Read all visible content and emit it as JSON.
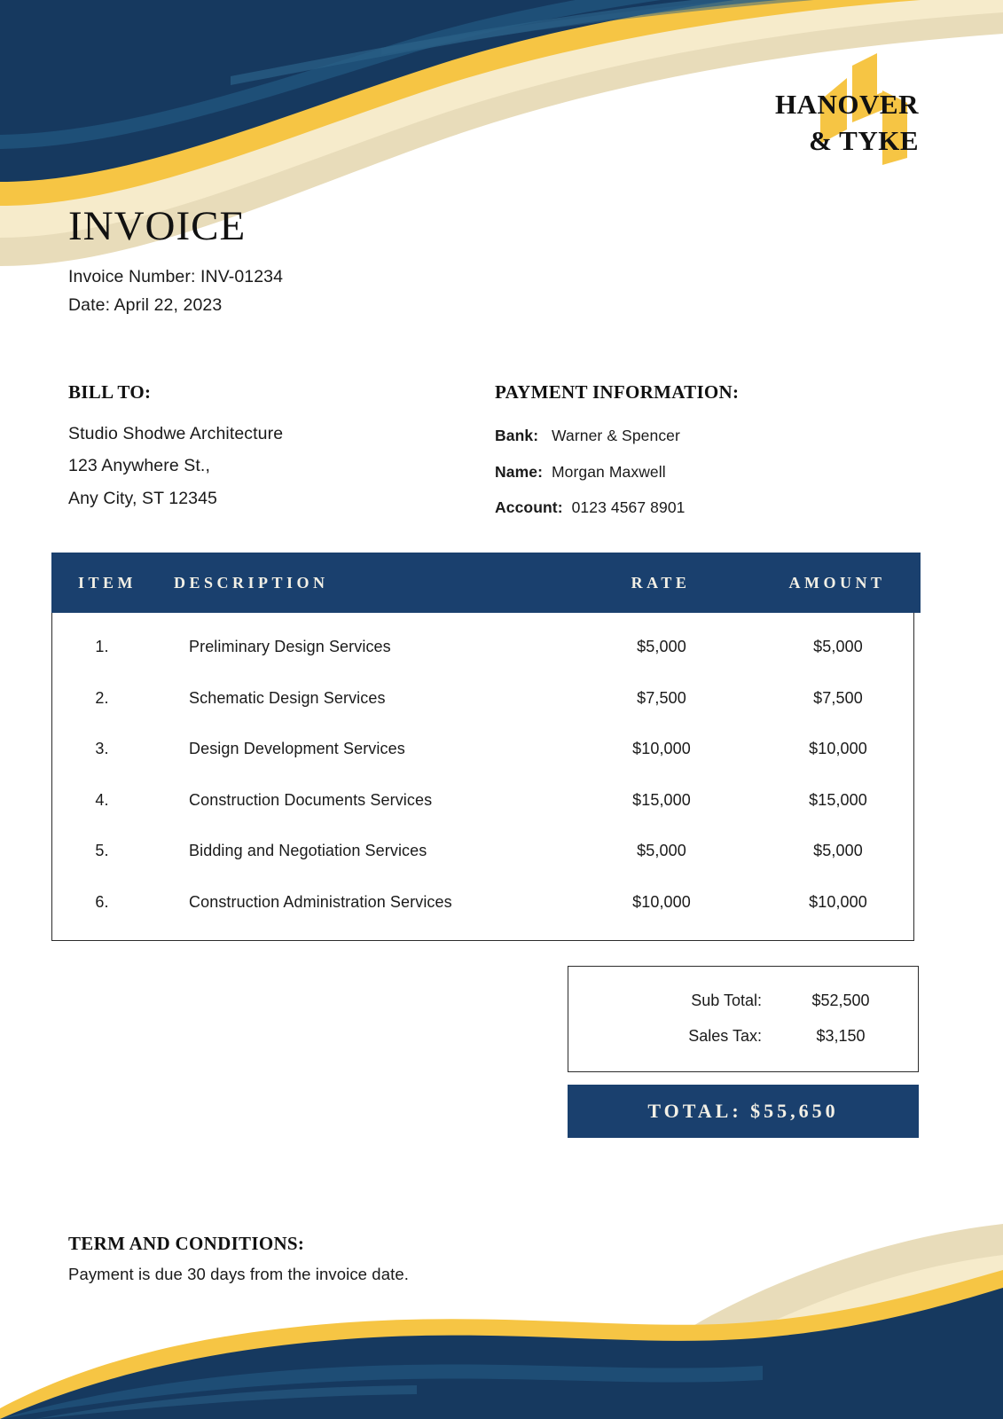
{
  "brand": {
    "logo_line1": "HANOVER",
    "logo_line2": "& TYKE",
    "logo_mark": "stylized-h-monogram",
    "navy": "#1A406E",
    "navy_dark": "#16395F",
    "blue_mid": "#1F5078",
    "gold": "#F6C544",
    "cream": "#F6EBCB",
    "cream_dark": "#E8DCBA",
    "header_text": "#F3F0E6"
  },
  "document": {
    "title": "INVOICE",
    "invoice_number_line": "Invoice Number: INV-01234",
    "date_line": "Date: April 22, 2023"
  },
  "bill_to": {
    "heading": "BILL TO:",
    "lines": [
      "Studio Shodwe Architecture",
      "123 Anywhere St.,",
      "Any City, ST 12345"
    ]
  },
  "payment_information": {
    "heading": "PAYMENT INFORMATION:",
    "rows": [
      {
        "label": "Bank:",
        "value": "Warner & Spencer"
      },
      {
        "label": "Name:",
        "value": "Morgan Maxwell"
      },
      {
        "label": "Account:",
        "value": "0123 4567 8901"
      }
    ]
  },
  "items_table": {
    "columns": [
      "ITEM",
      "DESCRIPTION",
      "RATE",
      "AMOUNT"
    ],
    "rows": [
      {
        "item": "1.",
        "description": "Preliminary Design Services",
        "rate": "$5,000",
        "amount": "$5,000"
      },
      {
        "item": "2.",
        "description": "Schematic Design Services",
        "rate": "$7,500",
        "amount": "$7,500"
      },
      {
        "item": "3.",
        "description": "Design Development Services",
        "rate": "$10,000",
        "amount": "$10,000"
      },
      {
        "item": "4.",
        "description": "Construction Documents Services",
        "rate": "$15,000",
        "amount": "$15,000"
      },
      {
        "item": "5.",
        "description": "Bidding and Negotiation Services",
        "rate": "$5,000",
        "amount": "$5,000"
      },
      {
        "item": "6.",
        "description": "Construction Administration Services",
        "rate": "$10,000",
        "amount": "$10,000"
      }
    ]
  },
  "totals": {
    "rows": [
      {
        "label": "Sub Total:",
        "value": "$52,500"
      },
      {
        "label": "Sales Tax:",
        "value": "$3,150"
      }
    ],
    "grand_total": "TOTAL: $55,650"
  },
  "terms": {
    "heading": "TERM AND CONDITIONS:",
    "text": "Payment is due 30 days from the invoice date."
  }
}
